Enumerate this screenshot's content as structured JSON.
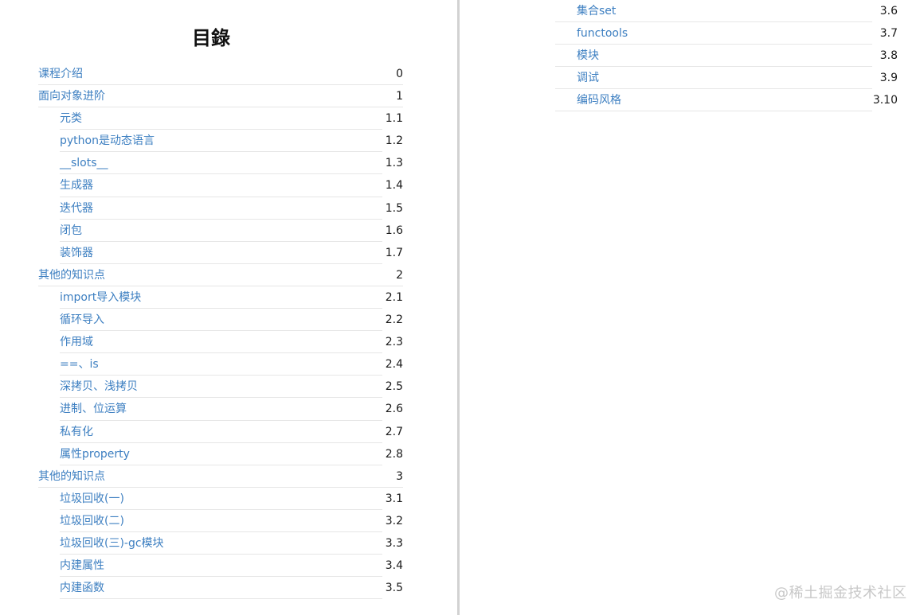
{
  "title": "目錄",
  "left_entries": [
    {
      "label": "课程介绍",
      "num": "0",
      "level": 1
    },
    {
      "label": "面向对象进阶",
      "num": "1",
      "level": 1
    },
    {
      "label": "元类",
      "num": "1.1",
      "level": 2
    },
    {
      "label": "python是动态语言",
      "num": "1.2",
      "level": 2
    },
    {
      "label": "__slots__",
      "num": "1.3",
      "level": 2
    },
    {
      "label": "生成器",
      "num": "1.4",
      "level": 2
    },
    {
      "label": "迭代器",
      "num": "1.5",
      "level": 2
    },
    {
      "label": "闭包",
      "num": "1.6",
      "level": 2
    },
    {
      "label": "装饰器",
      "num": "1.7",
      "level": 2
    },
    {
      "label": "其他的知识点",
      "num": "2",
      "level": 1
    },
    {
      "label": "import导入模块",
      "num": "2.1",
      "level": 2
    },
    {
      "label": "循环导入",
      "num": "2.2",
      "level": 2
    },
    {
      "label": "作用域",
      "num": "2.3",
      "level": 2
    },
    {
      "label": "==、is",
      "num": "2.4",
      "level": 2
    },
    {
      "label": "深拷贝、浅拷贝",
      "num": "2.5",
      "level": 2
    },
    {
      "label": "进制、位运算",
      "num": "2.6",
      "level": 2
    },
    {
      "label": "私有化",
      "num": "2.7",
      "level": 2
    },
    {
      "label": "属性property",
      "num": "2.8",
      "level": 2
    },
    {
      "label": "其他的知识点",
      "num": "3",
      "level": 1
    },
    {
      "label": "垃圾回收(一)",
      "num": "3.1",
      "level": 2
    },
    {
      "label": "垃圾回收(二)",
      "num": "3.2",
      "level": 2
    },
    {
      "label": "垃圾回收(三)-gc模块",
      "num": "3.3",
      "level": 2
    },
    {
      "label": "内建属性",
      "num": "3.4",
      "level": 2
    },
    {
      "label": "内建函数",
      "num": "3.5",
      "level": 2
    }
  ],
  "right_entries": [
    {
      "label": "集合set",
      "num": "3.6",
      "level": 2
    },
    {
      "label": "functools",
      "num": "3.7",
      "level": 2
    },
    {
      "label": "模块",
      "num": "3.8",
      "level": 2
    },
    {
      "label": "调试",
      "num": "3.9",
      "level": 2
    },
    {
      "label": "编码风格",
      "num": "3.10",
      "level": 2
    }
  ],
  "watermark": "@稀土掘金技术社区",
  "colors": {
    "link": "#3d7fc1",
    "number": "#1a1a1a",
    "rule": "#e6e6e6",
    "divider": "#d2d2d2"
  }
}
